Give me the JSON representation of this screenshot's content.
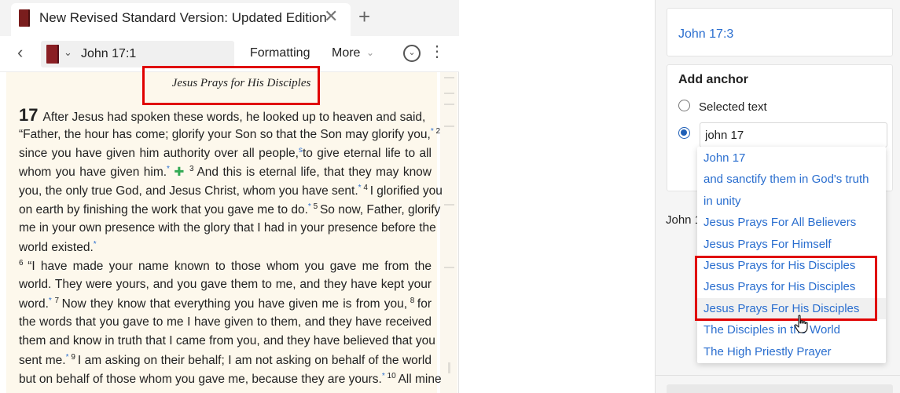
{
  "tab": {
    "title": "New Revised Standard Version: Updated Edition",
    "close_glyph": "✕",
    "add_glyph": "+"
  },
  "toolbar": {
    "back_glyph": "‹",
    "reference": "John 17:1",
    "formatting_label": "Formatting",
    "more_label": "More"
  },
  "passage": {
    "heading": "Jesus Prays for His Disciples",
    "chapter": "17",
    "lines": [
      [
        "After Jesus had spoken these words, he looked up to heaven and said,"
      ],
      [
        "“Father, the hour has come; glorify your Son so that the Son may glorify you,",
        "*",
        "2"
      ],
      [
        "since you have given him authority over all people,",
        "s",
        "to give eternal life to all"
      ],
      [
        "whom you have given him.",
        "*",
        "✚",
        "3",
        "And this is eternal life, that they may know"
      ],
      [
        "you, the only true God, and Jesus Christ, whom you have sent.",
        "*",
        "4",
        "I glorified you"
      ],
      [
        "on earth by finishing the work that you gave me to do.",
        "*",
        "5",
        "So now, Father, glorify"
      ],
      [
        "me in your own presence with the glory that I had in your presence before the"
      ],
      [
        "world existed.",
        "*"
      ],
      [
        "6",
        "“I have made your name known to those whom you gave me from the"
      ],
      [
        "world. They were yours, and you gave them to me, and they have kept your"
      ],
      [
        "word.",
        "*",
        "7",
        "Now they know that everything you have given me is from you,",
        "8",
        "for"
      ],
      [
        "the words that you gave to me I have given to them, and they have received"
      ],
      [
        "them and know in truth that I came from you, and they have believed that you"
      ],
      [
        "sent me.",
        "*",
        "9",
        "I am asking on their behalf; I am not asking on behalf of the world"
      ],
      [
        "but on behalf of those whom you gave me, because they are yours.",
        "*",
        "10",
        "All mine"
      ]
    ]
  },
  "right_panel": {
    "reference_link": "John 17:3",
    "add_anchor_title": "Add anchor",
    "selected_text_label": "Selected text",
    "anchor_input_value": "john 17",
    "partial_text": "John 1",
    "selected_option": "custom"
  },
  "dropdown": {
    "items": [
      "John 17",
      "and sanctify them in God's truth",
      "in unity",
      "Jesus Prays For All Believers",
      "Jesus Prays For Himself",
      "Jesus Prays for His Disciples",
      "Jesus Prays for His Disciples",
      "Jesus Prays For His Disciples",
      "The Disciples in the World",
      "The High Priestly Prayer"
    ],
    "hovered_index": 7
  },
  "colors": {
    "accent": "#2a6ecf",
    "highlight_box": "#e00000",
    "paper": "#fdf8ec"
  }
}
